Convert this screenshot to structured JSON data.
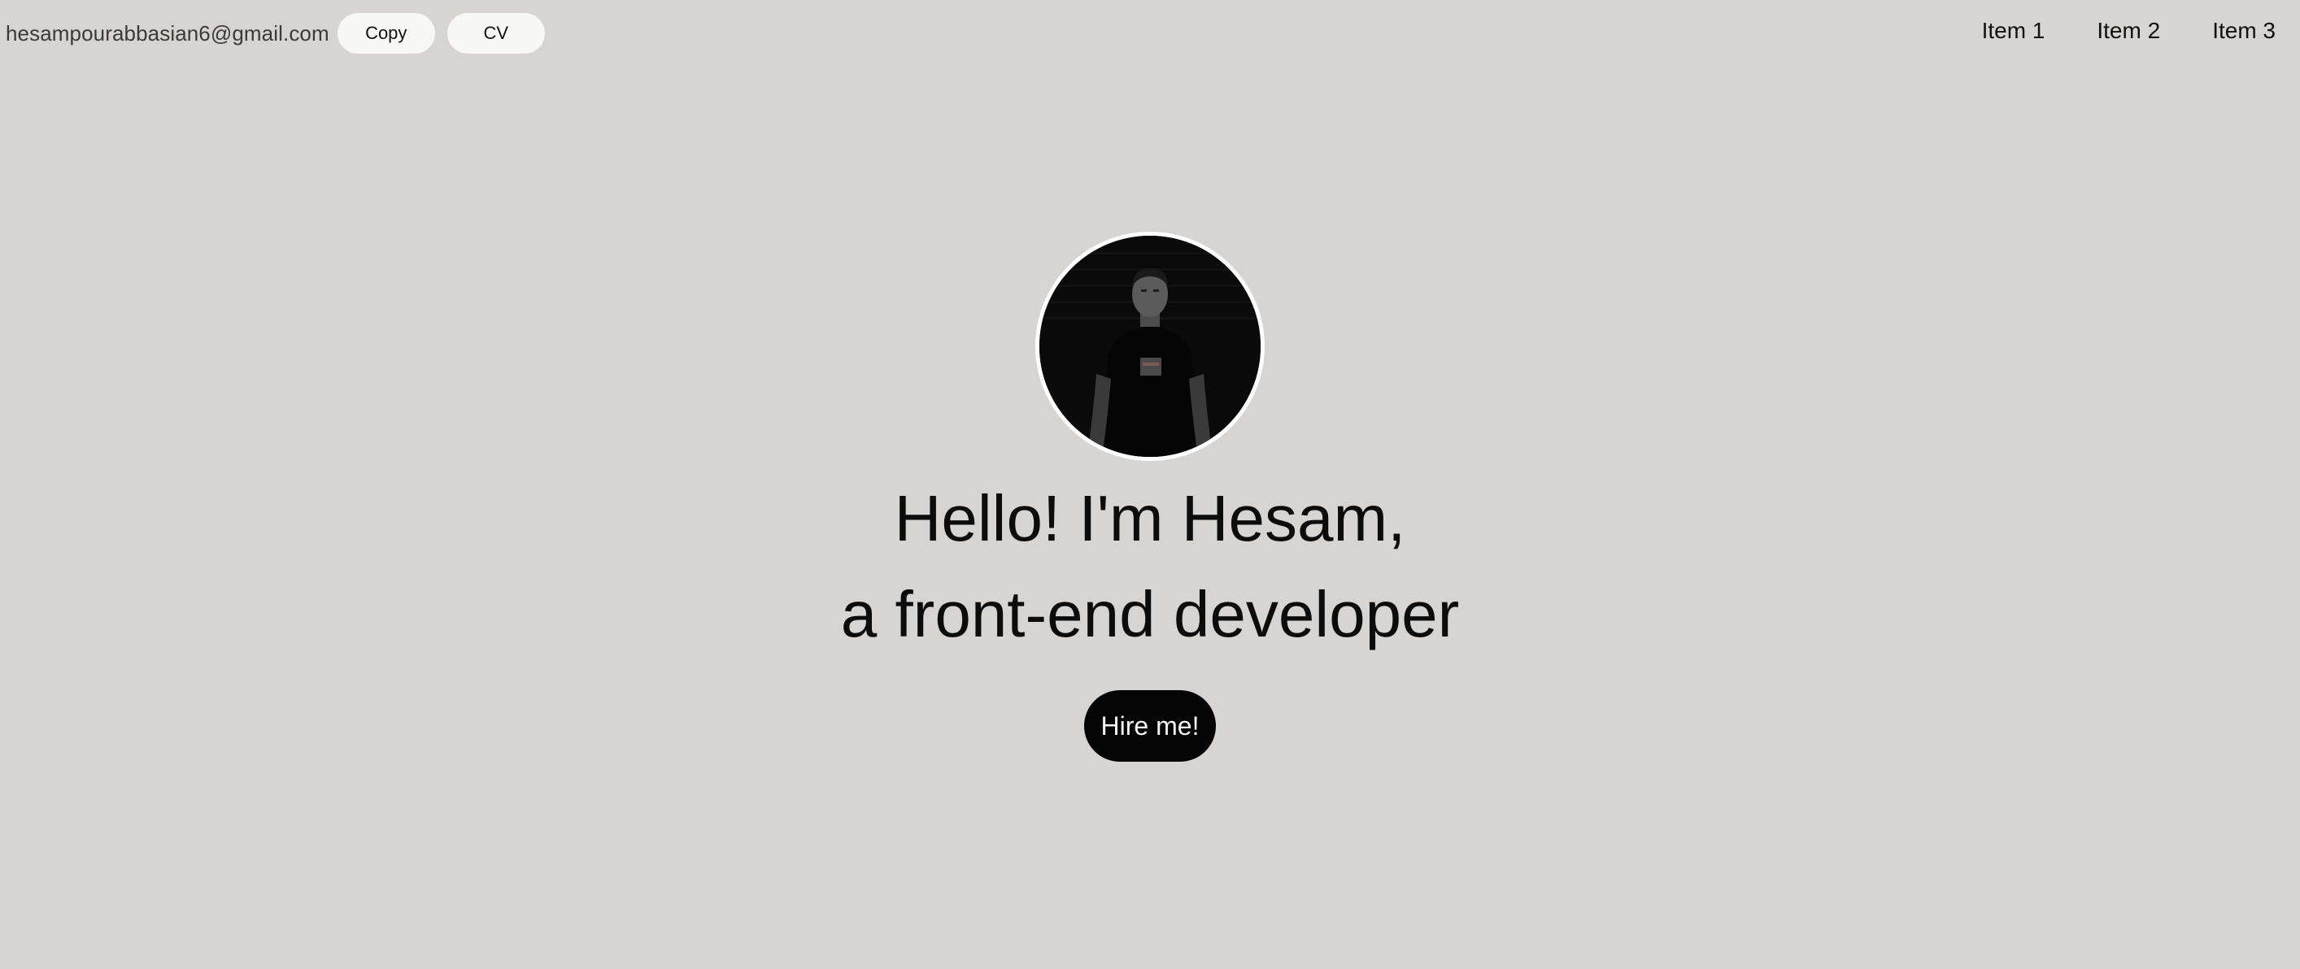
{
  "header": {
    "email": "hesampourabbasian6@gmail.com",
    "copy_label": "Copy",
    "cv_label": "CV",
    "nav_items": [
      {
        "label": "Item 1"
      },
      {
        "label": "Item 2"
      },
      {
        "label": "Item 3"
      }
    ]
  },
  "hero": {
    "avatar_icon": "profile-photo",
    "line1": "Hello! I'm Hesam,",
    "line2": "a front-end developer",
    "cta_label": "Hire me!"
  },
  "colors": {
    "background": "#d6d5d3",
    "button_light": "#f7f7f6",
    "cta_background": "#050505",
    "cta_text": "#f2f2f2"
  }
}
